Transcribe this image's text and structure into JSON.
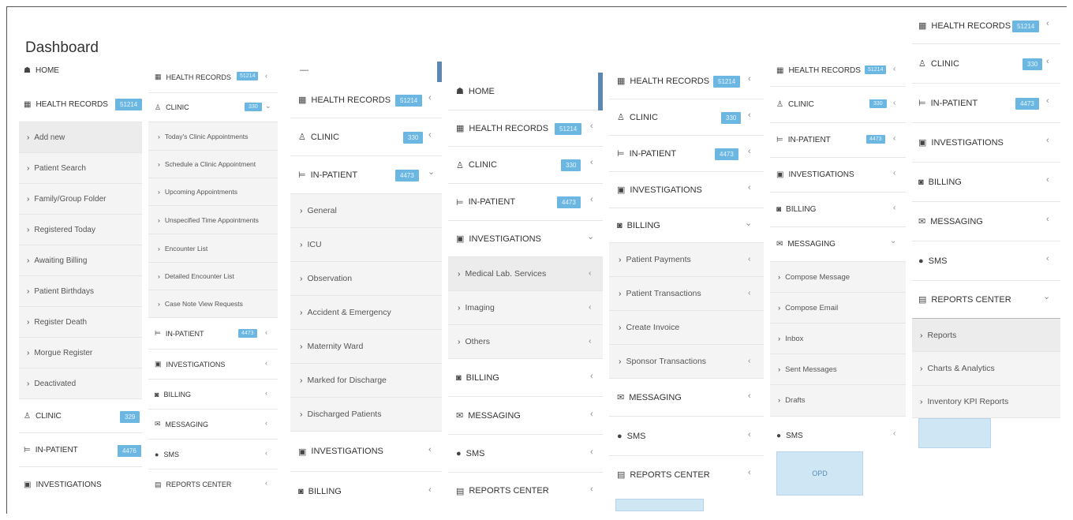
{
  "title": "Dashboard",
  "colors": {
    "badge": "#6bb7e2",
    "accent": "#5b87b0",
    "submenu_bg": "#f4f4f4",
    "lightbox": "#cfe6f5"
  },
  "p1": {
    "home": "HOME",
    "health_records": "HEALTH RECORDS",
    "health_badge": "51214",
    "items": [
      "Add new",
      "Patient Search",
      "Family/Group Folder",
      "Registered Today",
      "Awaiting Billing",
      "Patient Birthdays",
      "Register Death",
      "Morgue Register",
      "Deactivated"
    ],
    "clinic": "CLINIC",
    "clinic_badge": "329",
    "inpatient": "IN-PATIENT",
    "inpatient_badge": "4476",
    "investigations": "INVESTIGATIONS"
  },
  "p2": {
    "health_records": "HEALTH RECORDS",
    "health_badge": "51214",
    "clinic": "CLINIC",
    "clinic_badge": "330",
    "items": [
      "Today's Clinic Appointments",
      "Schedule a Clinic Appointment",
      "Upcoming Appointments",
      "Unspecified Time Appointments",
      "Encounter List",
      "Detailed Encounter List",
      "Case Note View Requests"
    ],
    "inpatient": "IN-PATIENT",
    "inpatient_badge": "4473",
    "investigations": "INVESTIGATIONS",
    "billing": "BILLING",
    "messaging": "MESSAGING",
    "sms": "SMS",
    "reports": "REPORTS CENTER"
  },
  "p3": {
    "health_records": "HEALTH RECORDS",
    "health_badge": "51214",
    "clinic": "CLINIC",
    "clinic_badge": "330",
    "inpatient": "IN-PATIENT",
    "inpatient_badge": "4473",
    "items": [
      "General",
      "ICU",
      "Observation",
      "Accident & Emergency",
      "Maternity Ward",
      "Marked for Discharge",
      "Discharged Patients"
    ],
    "investigations": "INVESTIGATIONS",
    "billing": "BILLING"
  },
  "p4": {
    "home": "HOME",
    "health_records": "HEALTH RECORDS",
    "health_badge": "51214",
    "clinic": "CLINIC",
    "clinic_badge": "330",
    "inpatient": "IN-PATIENT",
    "inpatient_badge": "4473",
    "investigations": "INVESTIGATIONS",
    "items": [
      "Medical Lab. Services",
      "Imaging",
      "Others"
    ],
    "billing": "BILLING",
    "messaging": "MESSAGING",
    "sms": "SMS",
    "reports": "REPORTS CENTER"
  },
  "p5": {
    "health_records": "HEALTH RECORDS",
    "health_badge": "51214",
    "clinic": "CLINIC",
    "clinic_badge": "330",
    "inpatient": "IN-PATIENT",
    "inpatient_badge": "4473",
    "investigations": "INVESTIGATIONS",
    "billing": "BILLING",
    "items": [
      "Patient Payments",
      "Patient Transactions",
      "Create Invoice",
      "Sponsor Transactions"
    ],
    "messaging": "MESSAGING",
    "sms": "SMS",
    "reports": "REPORTS CENTER"
  },
  "p6": {
    "health_records": "HEALTH RECORDS",
    "health_badge": "51214",
    "clinic": "CLINIC",
    "clinic_badge": "330",
    "inpatient": "IN-PATIENT",
    "inpatient_badge": "4473",
    "investigations": "INVESTIGATIONS",
    "billing": "BILLING",
    "messaging": "MESSAGING",
    "items": [
      "Compose Message",
      "Compose Email",
      "Inbox",
      "Sent Messages",
      "Drafts"
    ],
    "sms": "SMS",
    "opd": "OPD"
  },
  "p7": {
    "health_records": "HEALTH RECORDS",
    "health_badge": "51214",
    "clinic": "CLINIC",
    "clinic_badge": "330",
    "inpatient": "IN-PATIENT",
    "inpatient_badge": "4473",
    "investigations": "INVESTIGATIONS",
    "billing": "BILLING",
    "messaging": "MESSAGING",
    "sms": "SMS",
    "reports": "REPORTS CENTER",
    "items": [
      "Reports",
      "Charts & Analytics",
      "Inventory KPI Reports"
    ]
  }
}
